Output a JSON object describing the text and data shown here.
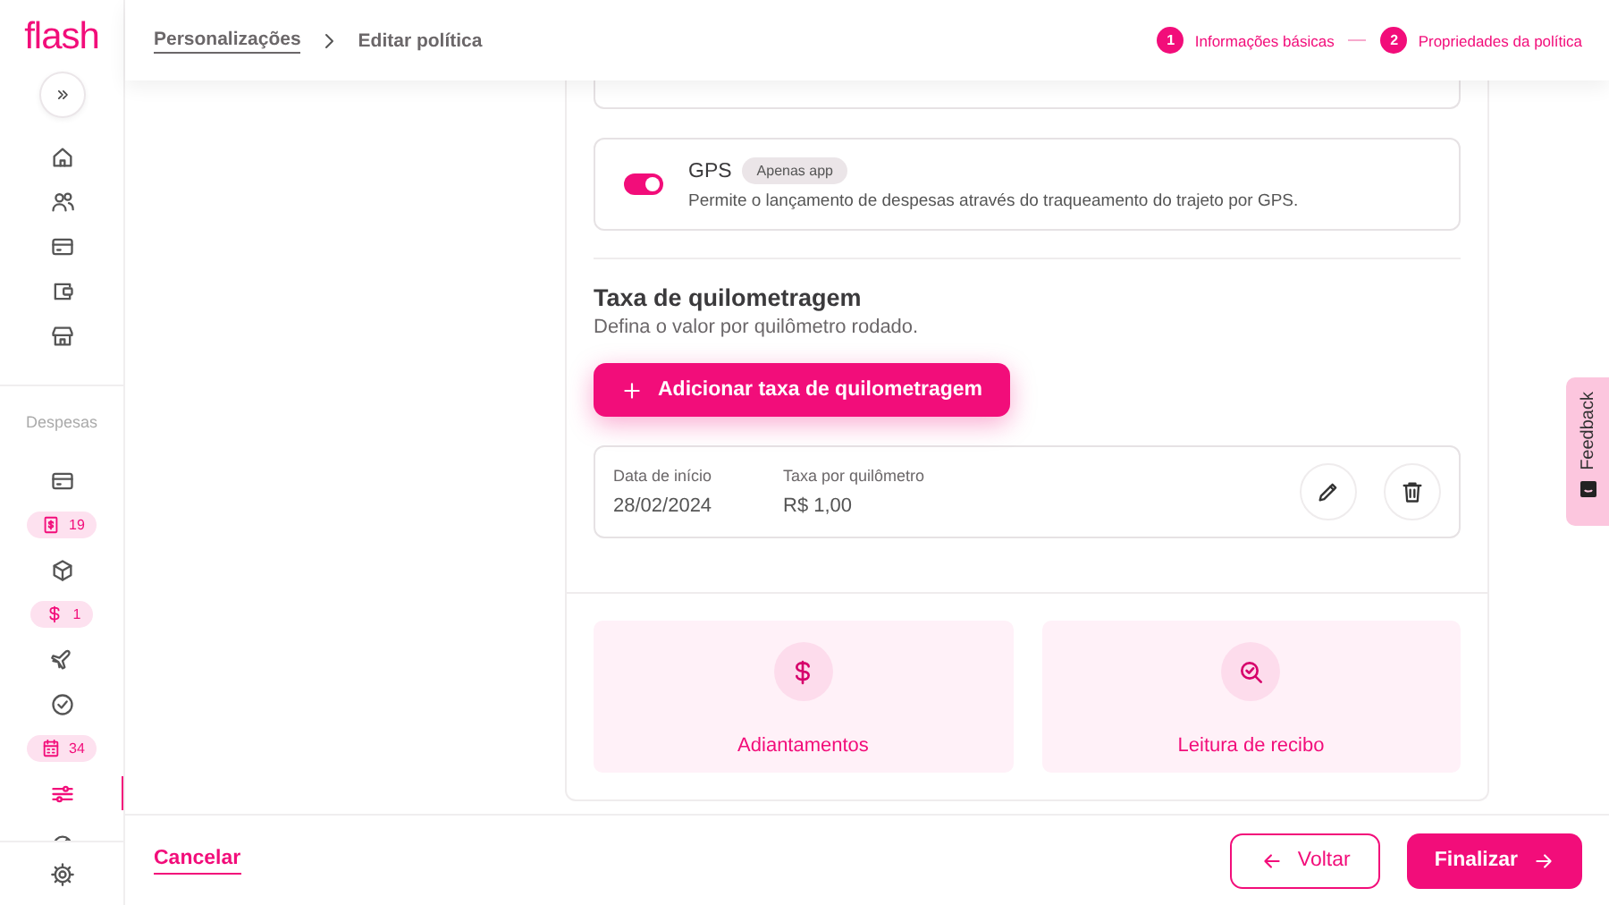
{
  "brand": "flash",
  "sidebar": {
    "top_items": [
      {
        "selected": false
      },
      {
        "selected": false
      },
      {
        "selected": false
      },
      {
        "selected": false
      },
      {
        "selected": false
      }
    ],
    "section_label": "Despesas",
    "items": [
      {
        "kind": "icon",
        "selected": false
      },
      {
        "kind": "badge",
        "count": "19",
        "selected": false
      },
      {
        "kind": "icon",
        "selected": false
      },
      {
        "kind": "badge",
        "count": "1",
        "selected": false
      },
      {
        "kind": "icon",
        "selected": false
      },
      {
        "kind": "icon",
        "selected": false
      },
      {
        "kind": "badge",
        "count": "34",
        "selected": false
      },
      {
        "kind": "icon",
        "selected": true
      },
      {
        "kind": "icon",
        "selected": false
      }
    ]
  },
  "breadcrumb": [
    "Personalizações",
    "Editar política"
  ],
  "steps": [
    {
      "number": "1",
      "label": "Informações básicas"
    },
    {
      "number": "2",
      "label": "Propriedades da política"
    }
  ],
  "gps": {
    "title": "GPS",
    "tag": "Apenas app",
    "description": "Permite o lançamento de despesas através do traqueamento do trajeto por GPS.",
    "on": true
  },
  "mileage": {
    "title": "Taxa de quilometragem",
    "subtitle": "Defina o valor por quilômetro rodado.",
    "add_button": "Adicionar taxa de quilometragem",
    "rates": [
      {
        "start_label": "Data de início",
        "start": "28/02/2024",
        "rate_label": "Taxa por quilômetro",
        "rate": "R$ 1,00"
      }
    ]
  },
  "features": [
    {
      "label": "Adiantamentos"
    },
    {
      "label": "Leitura de recibo"
    }
  ],
  "footer": {
    "cancel": "Cancelar",
    "back": "Voltar",
    "finish": "Finalizar"
  },
  "feedback": "Feedback"
}
